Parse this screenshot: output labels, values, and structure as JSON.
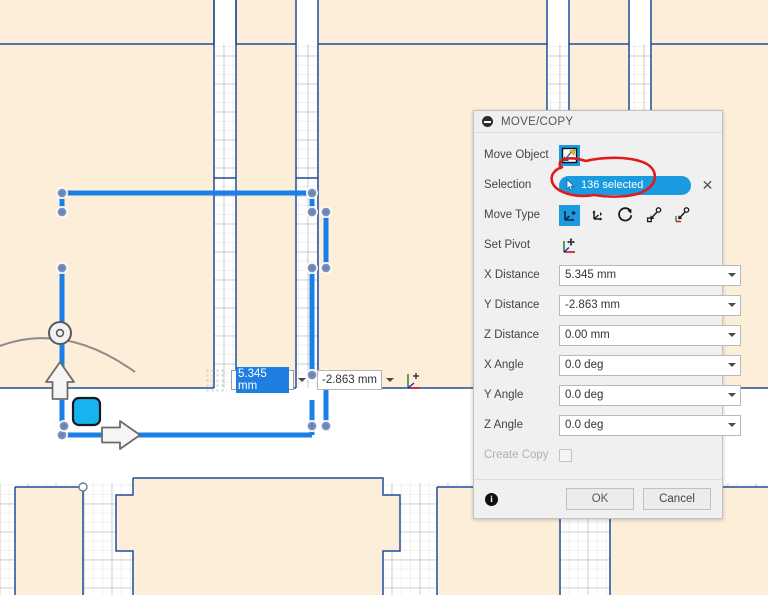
{
  "app": {
    "kind": "cad-sketch-editor",
    "canvas_bg": "#ffffff",
    "sketch_fill": "#fdeed9",
    "geometry_color": "#1f4e9c",
    "selection_color": "#1a80e8"
  },
  "dialog": {
    "title": "MOVE/COPY",
    "collapse_icon": "collapse-minus-icon",
    "rows": [
      {
        "label": "Move Object",
        "type": "icon",
        "icon": "move-object-icon"
      },
      {
        "label": "Selection",
        "type": "selection",
        "value": "136 selected",
        "cursor_icon": "cursor-arrow-icon",
        "clear_icon": "clear-x-icon"
      },
      {
        "label": "Move Type",
        "type": "icon-row"
      },
      {
        "label": "Set Pivot",
        "type": "icon",
        "icon": "set-pivot-icon"
      },
      {
        "label": "X Distance",
        "type": "input",
        "value": "5.345 mm"
      },
      {
        "label": "Y Distance",
        "type": "input",
        "value": "-2.863 mm"
      },
      {
        "label": "Z Distance",
        "type": "input",
        "value": "0.00 mm"
      },
      {
        "label": "X Angle",
        "type": "input",
        "value": "0.0 deg"
      },
      {
        "label": "Y Angle",
        "type": "input",
        "value": "0.0 deg"
      },
      {
        "label": "Z Angle",
        "type": "input",
        "value": "0.0 deg"
      },
      {
        "label": "Create Copy",
        "type": "checkbox",
        "checked": false,
        "disabled": true
      }
    ],
    "labels": {
      "move_object": "Move Object",
      "selection": "Selection",
      "move_type": "Move Type",
      "set_pivot": "Set Pivot",
      "x_distance": "X Distance",
      "y_distance": "Y Distance",
      "z_distance": "Z Distance",
      "x_angle": "X Angle",
      "y_angle": "Y Angle",
      "z_angle": "Z Angle",
      "create_copy": "Create Copy"
    },
    "values": {
      "selection": "136 selected",
      "x_distance": "5.345 mm",
      "y_distance": "-2.863 mm",
      "z_distance": "0.00 mm",
      "x_angle": "0.0 deg",
      "y_angle": "0.0 deg",
      "z_angle": "0.0 deg"
    },
    "move_types": [
      {
        "name": "free-move",
        "selected": true
      },
      {
        "name": "translate",
        "selected": false
      },
      {
        "name": "rotate",
        "selected": false
      },
      {
        "name": "point-to-point",
        "selected": false
      },
      {
        "name": "point-to-position",
        "selected": false
      }
    ],
    "footer": {
      "info_icon": "info-icon",
      "info_glyph": "i",
      "ok_label": "OK",
      "cancel_label": "Cancel"
    }
  },
  "canvas_inputs": {
    "x_value": "5.345 mm",
    "y_value": "-2.863 mm",
    "x_selected": true,
    "triad_icon": "move-triad-icon"
  },
  "annotation": {
    "type": "hand-drawn-ellipse",
    "color": "#e01b1b",
    "target": "selection-pill"
  }
}
